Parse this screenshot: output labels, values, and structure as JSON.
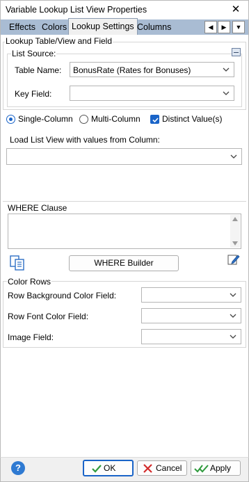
{
  "window": {
    "title": "Variable Lookup List View Properties",
    "close_glyph": "✕"
  },
  "tabs": [
    {
      "label": "Effects"
    },
    {
      "label": "Colors"
    },
    {
      "label": "Lookup Settings",
      "active": true
    },
    {
      "label": "Columns"
    }
  ],
  "tab_nav": {
    "prev_glyph": "◀",
    "next_glyph": "▶",
    "menu_glyph": "▼"
  },
  "lookup": {
    "heading": "Lookup Table/View and Field",
    "list_source_label": "List Source:",
    "table_name_label": "Table Name:",
    "table_name_value": "BonusRate  (Rates for Bonuses)",
    "key_field_label": "Key Field:",
    "key_field_value": ""
  },
  "options": {
    "single_column_label": "Single-Column",
    "single_column_selected": true,
    "multi_column_label": "Multi-Column",
    "multi_column_selected": false,
    "distinct_label": "Distinct Value(s)",
    "distinct_checked": true
  },
  "load": {
    "label": "Load List View with values from Column:",
    "value": ""
  },
  "where": {
    "heading": "WHERE Clause",
    "text": "",
    "builder_label": "WHERE Builder"
  },
  "color_rows": {
    "heading": "Color Rows",
    "row_bg_label": "Row Background Color Field:",
    "row_font_label": "Row Font Color Field:",
    "image_label": "Image Field:"
  },
  "footer": {
    "help_glyph": "?",
    "ok_label": "OK",
    "cancel_label": "Cancel",
    "apply_label": "Apply"
  },
  "colors": {
    "accent": "#1a64c8",
    "tabstrip": "#a9bcd3",
    "ok_check": "#2e9a3c",
    "cancel_x": "#d22b2b"
  }
}
